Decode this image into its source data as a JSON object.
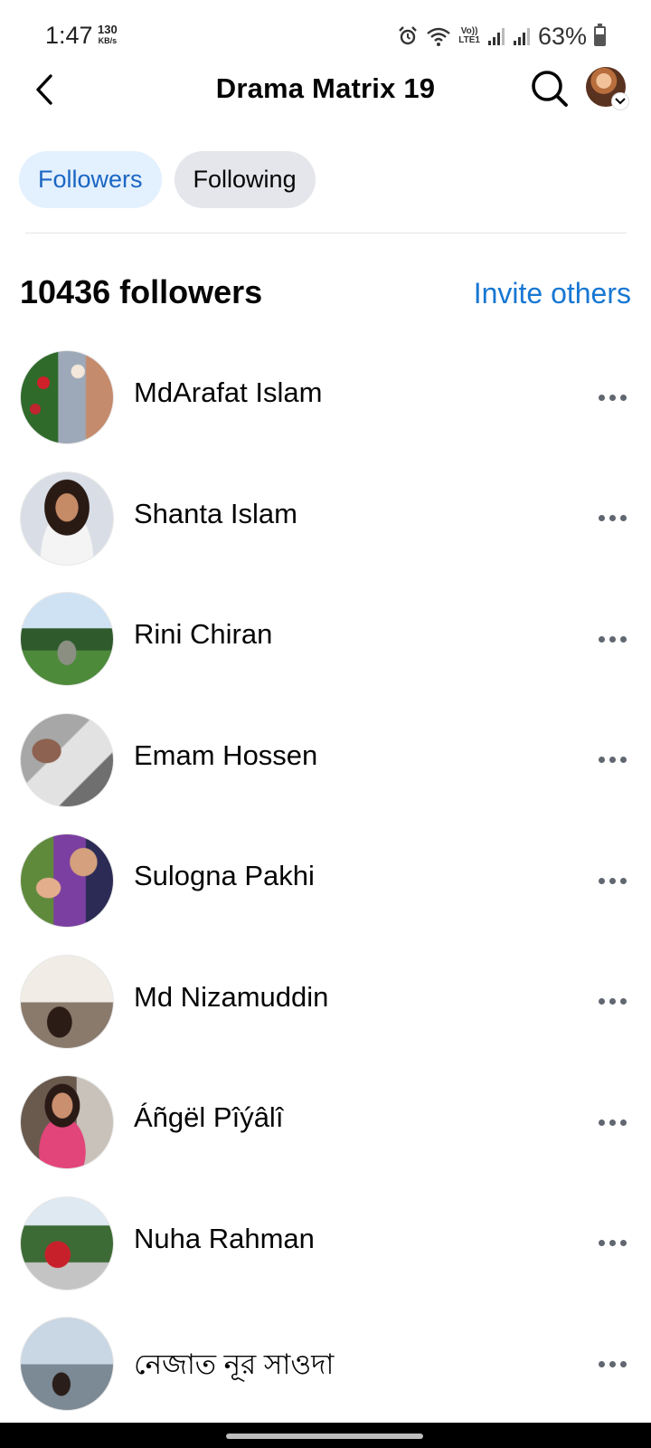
{
  "status_bar": {
    "time": "1:47",
    "speed_value": "130",
    "speed_unit": "KB/s",
    "volte_label": "Vo))",
    "lte_label": "LTE1",
    "battery_percent": "63%",
    "icons": [
      "alarm-icon",
      "wifi-icon",
      "signal-icon",
      "signal-icon",
      "battery-icon"
    ]
  },
  "header": {
    "title": "Drama Matrix 19",
    "back_icon": "chevron-left-icon",
    "search_icon": "search-icon"
  },
  "tabs": [
    {
      "label": "Followers",
      "active": true
    },
    {
      "label": "Following",
      "active": false
    }
  ],
  "summary": {
    "count_text": "10436 followers",
    "invite_label": "Invite others"
  },
  "followers": [
    {
      "name": "MdArafat Islam"
    },
    {
      "name": "Shanta Islam"
    },
    {
      "name": "Rini Chiran"
    },
    {
      "name": "Emam Hossen"
    },
    {
      "name": "Sulogna Pakhi"
    },
    {
      "name": "Md Nizamuddin"
    },
    {
      "name": "Áñgël Pîýâlî"
    },
    {
      "name": "Nuha Rahman"
    },
    {
      "name": "নেজাত নূর সাওদা"
    }
  ],
  "colors": {
    "accent": "#1877d2",
    "tab_active_bg": "#e3f0fd",
    "tab_inactive_bg": "#e4e6eb",
    "text": "#050505"
  }
}
